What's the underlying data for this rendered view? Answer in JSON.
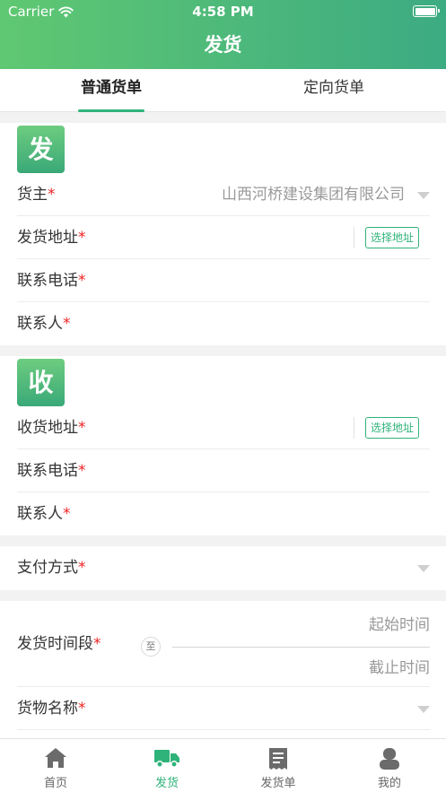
{
  "status_bar": {
    "carrier": "Carrier",
    "time": "4:58 PM"
  },
  "nav": {
    "title": "发货"
  },
  "tabs": [
    {
      "label": "普通货单",
      "active": true
    },
    {
      "label": "定向货单",
      "active": false
    }
  ],
  "sender": {
    "badge": "发",
    "owner": {
      "label": "货主",
      "value": "山西河桥建设集团有限公司"
    },
    "address": {
      "label": "发货地址",
      "button": "选择地址"
    },
    "phone": {
      "label": "联系电话"
    },
    "contact": {
      "label": "联系人"
    }
  },
  "receiver": {
    "badge": "收",
    "address": {
      "label": "收货地址",
      "button": "选择地址"
    },
    "phone": {
      "label": "联系电话"
    },
    "contact": {
      "label": "联系人"
    }
  },
  "payment": {
    "label": "支付方式"
  },
  "time_range": {
    "label": "发货时间段",
    "to": "至",
    "start_placeholder": "起始时间",
    "end_placeholder": "截止时间"
  },
  "goods": {
    "label": "货物名称"
  },
  "required_mark": "*",
  "tabbar": [
    {
      "label": "首页",
      "icon": "home-icon",
      "active": false
    },
    {
      "label": "发货",
      "icon": "truck-icon",
      "active": true
    },
    {
      "label": "发货单",
      "icon": "receipt-icon",
      "active": false
    },
    {
      "label": "我的",
      "icon": "user-icon",
      "active": false
    }
  ],
  "colors": {
    "accent": "#2fb37a",
    "header_start": "#5fc872",
    "header_end": "#3dab82",
    "required": "#e22222"
  }
}
